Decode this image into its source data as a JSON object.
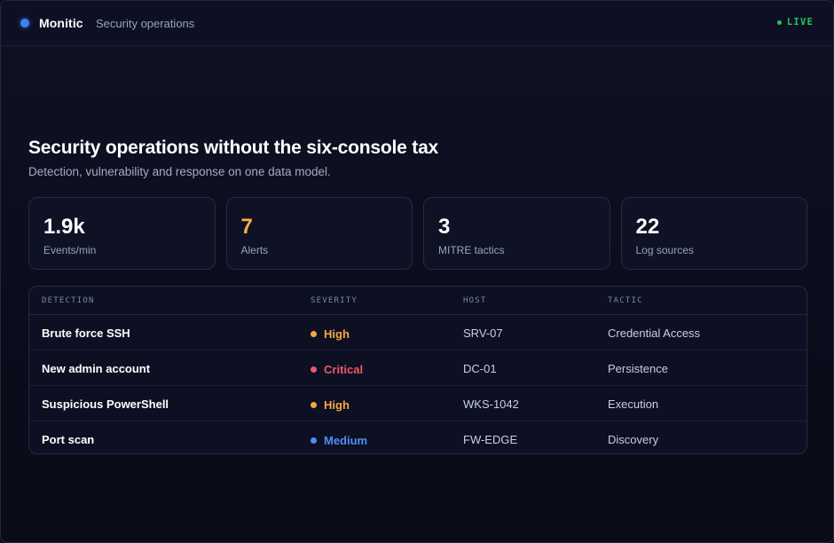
{
  "app": {
    "name": "Monitic",
    "section": "Security operations",
    "status": "LIVE",
    "colors": {
      "brand": "#3b82f6",
      "live": "#22c55e"
    }
  },
  "hero": {
    "title": "Security operations without the six-console tax",
    "subtitle": "Detection, vulnerability and response on one data model."
  },
  "stats": [
    {
      "value": "1.9k",
      "label": "Events/min"
    },
    {
      "value": "7",
      "label": "Alerts",
      "accent": "#fbae4a"
    },
    {
      "value": "3",
      "label": "MITRE tactics"
    },
    {
      "value": "22",
      "label": "Log sources"
    }
  ],
  "table": {
    "headers": [
      "DETECTION",
      "SEVERITY",
      "HOST",
      "TACTIC"
    ],
    "rows": [
      {
        "detection": "Brute force SSH",
        "severity": "High",
        "severity_color": "#f5a742",
        "host": "SRV-07",
        "tactic": "Credential Access"
      },
      {
        "detection": "New admin account",
        "severity": "Critical",
        "severity_color": "#f0566a",
        "host": "DC-01",
        "tactic": "Persistence"
      },
      {
        "detection": "Suspicious PowerShell",
        "severity": "High",
        "severity_color": "#f5a742",
        "host": "WKS-1042",
        "tactic": "Execution"
      },
      {
        "detection": "Port scan",
        "severity": "Medium",
        "severity_color": "#4f8df7",
        "host": "FW-EDGE",
        "tactic": "Discovery"
      }
    ]
  }
}
